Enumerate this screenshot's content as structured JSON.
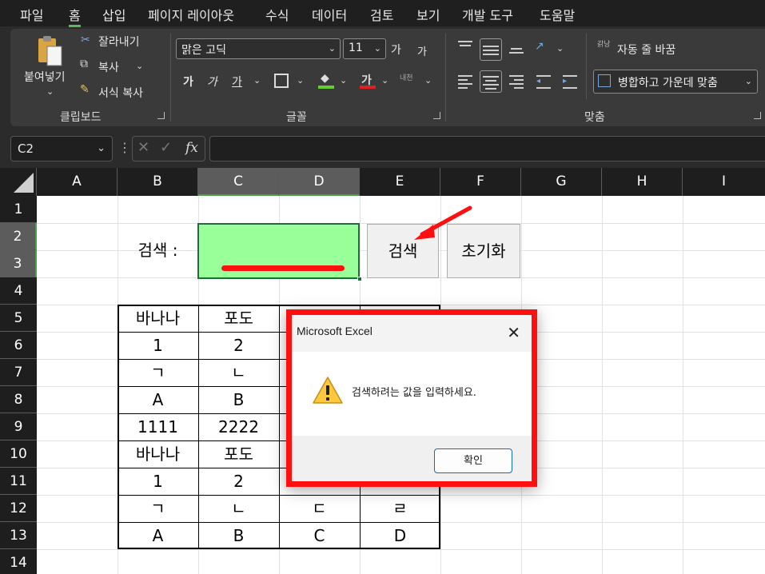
{
  "menu": [
    "파일",
    "홈",
    "삽입",
    "페이지 레이아웃",
    "수식",
    "데이터",
    "검토",
    "보기",
    "개발 도구",
    "도움말"
  ],
  "menu_active": "홈",
  "ribbon": {
    "clipboard": {
      "paste": "붙여넣기",
      "cut": "잘라내기",
      "copy": "복사",
      "format_painter": "서식 복사",
      "label": "클립보드"
    },
    "font": {
      "font_name": "맑은 고딕",
      "font_size": "11",
      "grow": "가",
      "shrink": "가",
      "bold": "가",
      "italic": "가",
      "underline": "가",
      "font_color_glyph": "가",
      "phonetic": "내천",
      "label": "글꼴"
    },
    "alignment": {
      "wrap_text": "자동 줄 바꿈",
      "merge_center": "병합하고 가운데 맞춤",
      "wrap_icon_text": "갉낭",
      "label": "맞춤"
    }
  },
  "formula_bar": {
    "name_box": "C2",
    "fx": "fx",
    "formula": ""
  },
  "columns": [
    "A",
    "B",
    "C",
    "D",
    "E",
    "F",
    "G",
    "H",
    "I"
  ],
  "rows": [
    "1",
    "2",
    "3",
    "4",
    "5",
    "6",
    "7",
    "8",
    "9",
    "10",
    "11",
    "12",
    "13",
    "14"
  ],
  "sheet": {
    "search_label": "검색 :",
    "search_button": "검색",
    "reset_button": "초기화",
    "table": [
      [
        "바나나",
        "포도",
        "",
        ""
      ],
      [
        "1",
        "2",
        "",
        ""
      ],
      [
        "ㄱ",
        "ㄴ",
        "",
        ""
      ],
      [
        "A",
        "B",
        "",
        ""
      ],
      [
        "1111",
        "2222",
        "",
        ""
      ],
      [
        "바나나",
        "포도",
        "",
        ""
      ],
      [
        "1",
        "2",
        "",
        ""
      ],
      [
        "ㄱ",
        "ㄴ",
        "ㄷ",
        "ㄹ"
      ],
      [
        "A",
        "B",
        "C",
        "D"
      ]
    ]
  },
  "dialog": {
    "title": "Microsoft Excel",
    "message": "검색하려는 값을 입력하세요.",
    "ok": "확인"
  },
  "colors": {
    "input_cell": "#99ff99",
    "highlight_red": "#ff1010",
    "selected_accent": "#4a9d4a"
  }
}
